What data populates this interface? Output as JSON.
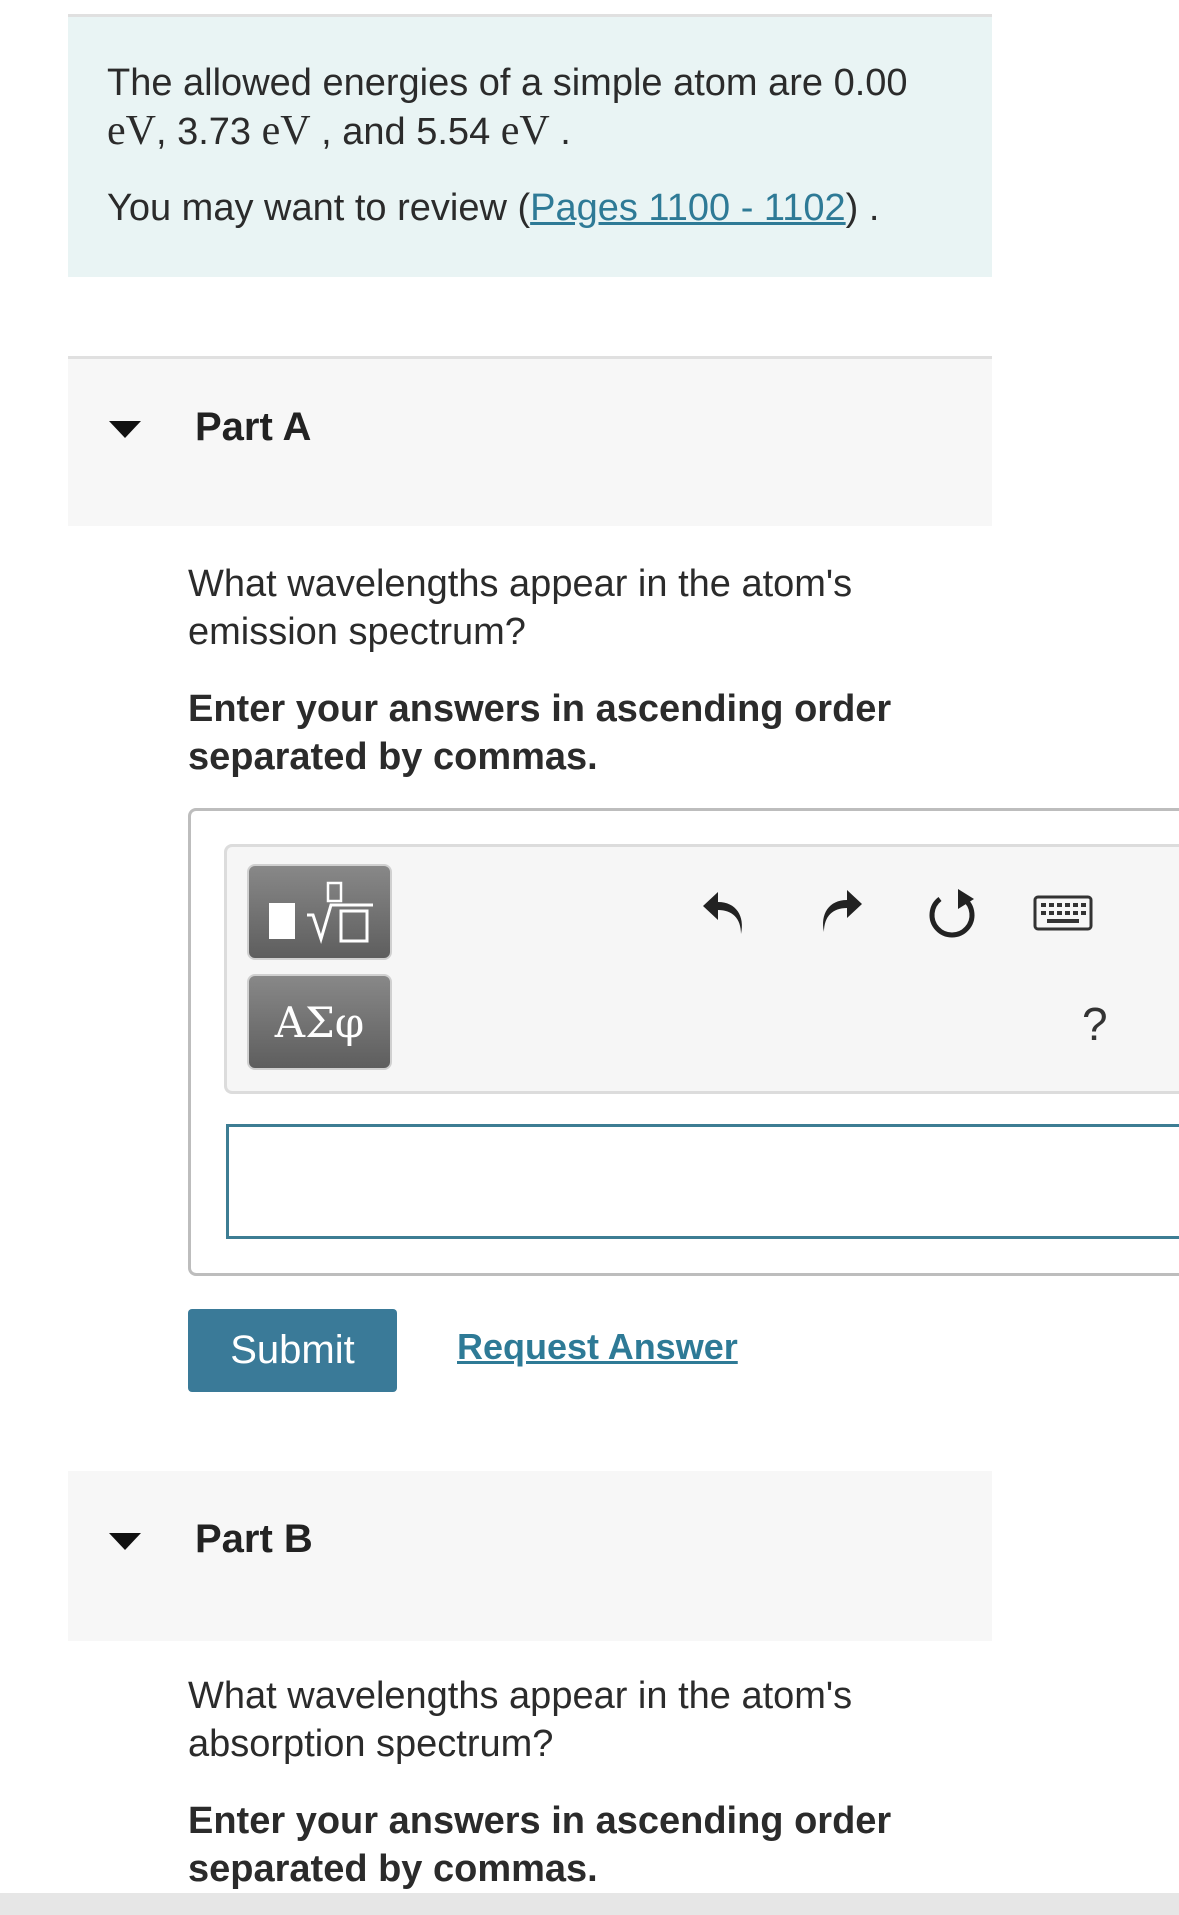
{
  "intro": {
    "text_1": "The allowed energies of a simple atom are 0.00",
    "unit_1": "eV",
    "text_2": ", 3.73",
    "unit_2": "eV",
    "text_3": " , and 5.54",
    "unit_3": "eV",
    "text_4": " .",
    "review_prefix": "You may want to review (",
    "review_link": "Pages 1100 - 1102",
    "review_suffix": ") ."
  },
  "part_a": {
    "title": "Part A",
    "question": "What wavelengths appear in the atom's emission spectrum?",
    "instruction": "Enter your answers in ascending order separated by commas.",
    "input_value": "",
    "submit_label": "Submit",
    "request_label": "Request Answer"
  },
  "toolbar": {
    "greek_label": "ΑΣφ",
    "help_label": "?",
    "icons": [
      "templates-icon",
      "undo-icon",
      "redo-icon",
      "reset-icon",
      "keyboard-icon"
    ]
  },
  "part_b": {
    "title": "Part B",
    "question": "What wavelengths appear in the atom's absorption spectrum?",
    "instruction": "Enter your answers in ascending order separated by commas."
  },
  "colors": {
    "intro_bg": "#e9f4f4",
    "link": "#2e7a96",
    "submit_bg": "#3a7a98",
    "input_border": "#3d7d93"
  }
}
